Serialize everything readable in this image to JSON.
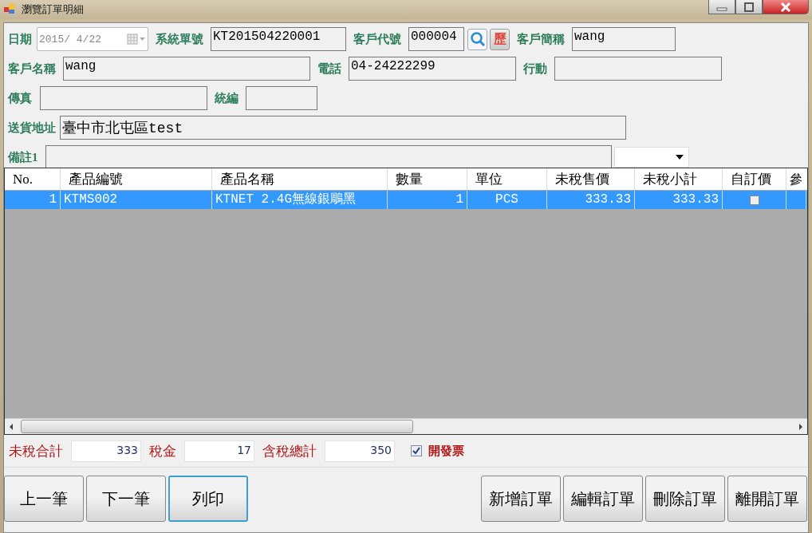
{
  "window": {
    "title": "瀏覽訂單明細"
  },
  "form": {
    "lines": [
      {
        "fields": [
          {
            "kind": "date",
            "label": "日期",
            "value": "2015/ 4/22",
            "disabled": true
          },
          {
            "kind": "text",
            "label": "系統單號",
            "value": "KT201504220001"
          },
          {
            "kind": "lookup",
            "label": "客戶代號",
            "value": "000004",
            "button": "歷"
          },
          {
            "kind": "text",
            "label": "客戶簡稱",
            "value": "wang"
          }
        ]
      },
      {
        "fields": [
          {
            "kind": "text",
            "label": "客戶名稱",
            "value": "wang"
          },
          {
            "kind": "text",
            "label": "電話",
            "value": "04-24222299"
          },
          {
            "kind": "text",
            "label": "行動"
          }
        ]
      },
      {
        "fields": [
          {
            "kind": "text",
            "label": "傳真"
          },
          {
            "kind": "text",
            "label": "統編"
          }
        ]
      },
      {
        "fields": [
          {
            "kind": "text",
            "label": "送貨地址",
            "value": "臺中市北屯區test"
          }
        ]
      },
      {
        "fields": [
          {
            "kind": "combo",
            "label": "備註1"
          }
        ]
      }
    ]
  },
  "table": {
    "columns": [
      "No.",
      "產品編號",
      "產品名稱",
      "數量",
      "單位",
      "未稅售價",
      "未稅小計",
      "自訂價",
      "參"
    ],
    "rows": [
      {
        "selected": true,
        "cells": [
          "1",
          "KTMS002",
          "KTNET 2.4G無線銀鵰黑",
          "1",
          "PCS",
          "333.33",
          "333.33"
        ],
        "custom_price": false
      }
    ]
  },
  "totals": [
    {
      "label": "未稅合計",
      "value": "333"
    },
    {
      "label": "稅金",
      "value": "17"
    },
    {
      "label": "含稅總計",
      "value": "350"
    }
  ],
  "invoice": {
    "label": "開發票",
    "checked": true
  },
  "buttons_left": [
    {
      "label": "上一筆",
      "focused": false
    },
    {
      "label": "下一筆",
      "focused": false
    },
    {
      "label": "列印",
      "focused": true
    }
  ],
  "buttons_right": [
    {
      "label": "新增訂單",
      "focused": false
    },
    {
      "label": "編輯訂單",
      "focused": false
    },
    {
      "label": "刪除訂單",
      "focused": false
    },
    {
      "label": "離開訂單",
      "focused": false
    }
  ]
}
